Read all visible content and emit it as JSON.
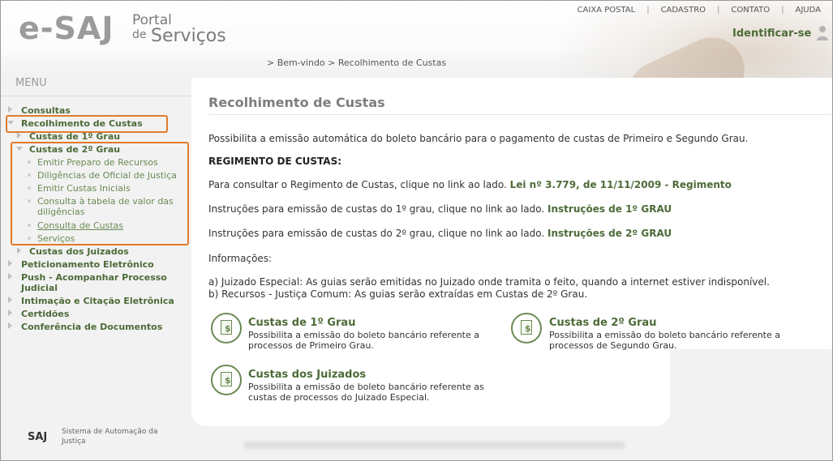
{
  "header": {
    "logo_esaj": "e-SAJ",
    "logo_portal": "Portal",
    "logo_de": "de",
    "logo_servicos": "Serviços",
    "topnav": [
      "CAIXA POSTAL",
      "CADASTRO",
      "CONTATO",
      "AJUDA"
    ],
    "separator": "|",
    "identify": "Identificar-se"
  },
  "breadcrumb": {
    "items": [
      "> Bem-vindo",
      "> Recolhimento de Custas"
    ]
  },
  "menu": {
    "title": "MENU",
    "items": [
      "Consultas",
      "Recolhimento de Custas",
      "Custas de 1º Grau",
      "Custas de 2º Grau",
      "Emitir Preparo de Recursos",
      "Diligências de Oficial de Justiça",
      "Emitir Custas Iniciais",
      "Consulta à tabela de valor das",
      "diligências",
      "Consulta de Custas",
      "Serviços",
      "Custas dos Juizados",
      "Peticionamento Eletrônico",
      "Push - Acompanhar Processo",
      "Judicial",
      "Intimação e Citação Eletrônica",
      "Certidões",
      "Conferência de Documentos"
    ]
  },
  "footer": {
    "logo": "SAJ",
    "line1": "Sistema de Automação da",
    "line2": "Justiça"
  },
  "main": {
    "title": "Recolhimento de Custas",
    "intro": "Possibilita a emissão automática do boleto bancário para o pagamento de custas de Primeiro e Segundo Grau.",
    "regimento_heading": "REGIMENTO DE CUSTAS:",
    "regimento_text": "Para consultar o Regimento de Custas, clique no link ao lado.",
    "regimento_link": "Lei nº 3.779, de 11/11/2009 - Regimento",
    "inst1_text": "Instruções para emissão de custas do 1º grau, clique no link ao lado.",
    "inst1_link": "Instruções de 1º GRAU",
    "inst2_text": "Instruções para emissão de custas do 2º grau, clique no link ao lado.",
    "inst2_link": "Instruções de 2º GRAU",
    "info_label": "Informações:",
    "info_a": "a) Juizado Especial: As guias serão emitidas no Juizado onde tramita o feito, quando a internet estiver indisponível.",
    "info_b": "b) Recursos - Justiça Comum: As guias serão extraídas em Custas de 2º Grau.",
    "cards": [
      {
        "title": "Custas de 1º Grau",
        "desc1": "Possibilita a emissão do boleto bancário referente a",
        "desc2": "processos de Primeiro Grau.",
        "icon": "money-document-icon"
      },
      {
        "title": "Custas de 2º Grau",
        "desc1": "Possibilita a emissão do boleto bancário referente a",
        "desc2": "processos de Segundo Grau.",
        "icon": "money-document-icon"
      },
      {
        "title": "Custas dos Juizados",
        "desc1": "Possibilita a emissão de boleto bancário referente as",
        "desc2": "custas de processos do Juizado Especial.",
        "icon": "money-document-icon"
      }
    ]
  },
  "colors": {
    "accent_green": "#4d6b38",
    "highlight_orange": "#e07b2c"
  }
}
